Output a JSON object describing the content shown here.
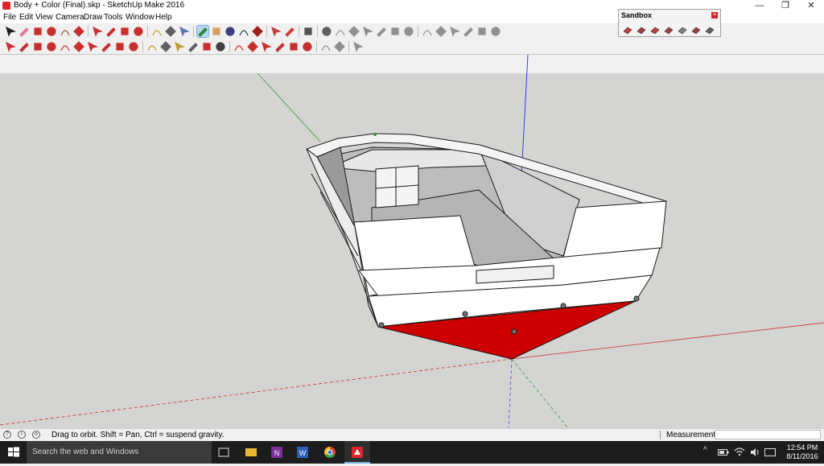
{
  "window": {
    "title": "Body + Color (Final).skp - SketchUp Make 2016",
    "controls": {
      "minimize": "—",
      "maximize": "❐",
      "close": "✕"
    }
  },
  "menu": [
    "File",
    "Edit",
    "View",
    "Camera",
    "Draw",
    "Tools",
    "Window",
    "Help"
  ],
  "toolbar_row1": [
    {
      "icon": "select-arrow-icon",
      "color": "#202020"
    },
    {
      "icon": "eraser-icon",
      "color": "#e07a9a"
    },
    {
      "icon": "pencil-line-icon",
      "color": "#c83030"
    },
    {
      "icon": "arc-icon",
      "color": "#c83030"
    },
    {
      "icon": "rectangle-icon",
      "color": "#8a5a3a"
    },
    {
      "icon": "push-pull-icon",
      "color": "#c83030"
    },
    {
      "icon": "move-icon",
      "color": "#c83030"
    },
    {
      "icon": "rotate-icon",
      "color": "#c83030"
    },
    {
      "icon": "scale-icon",
      "color": "#c83030"
    },
    {
      "icon": "offset-icon",
      "color": "#c83030"
    },
    {
      "icon": "tape-measure-icon",
      "color": "#c0a030"
    },
    {
      "icon": "text-icon",
      "color": "#606060"
    },
    {
      "icon": "paint-bucket-icon",
      "color": "#5a7ab0"
    },
    {
      "icon": "orbit-icon",
      "color": "#2a8a3a"
    },
    {
      "icon": "pan-icon",
      "color": "#d8a060"
    },
    {
      "icon": "zoom-icon",
      "color": "#404080"
    },
    {
      "icon": "zoom-extents-icon",
      "color": "#404040"
    },
    {
      "icon": "previous-view-icon",
      "color": "#a02020"
    },
    {
      "icon": "warehouse-icon",
      "color": "#c04040"
    },
    {
      "icon": "extension-icon",
      "color": "#d04040"
    },
    {
      "icon": "layout-icon",
      "color": "#505050"
    },
    {
      "icon": "iso-view-icon",
      "color": "#606060"
    },
    {
      "icon": "top-view-icon",
      "color": "#909090"
    },
    {
      "icon": "front-view-icon",
      "color": "#909090"
    },
    {
      "icon": "right-view-icon",
      "color": "#909090"
    },
    {
      "icon": "back-view-icon",
      "color": "#909090"
    },
    {
      "icon": "left-view-icon",
      "color": "#909090"
    },
    {
      "icon": "xray-icon",
      "color": "#909090"
    },
    {
      "icon": "back-edges-icon",
      "color": "#909090"
    },
    {
      "icon": "wireframe-icon",
      "color": "#909090"
    },
    {
      "icon": "hidden-line-icon",
      "color": "#909090"
    },
    {
      "icon": "shaded-icon",
      "color": "#909090"
    },
    {
      "icon": "shaded-textures-icon",
      "color": "#909090"
    },
    {
      "icon": "monochrome-icon",
      "color": "#909090"
    }
  ],
  "toolbar_row2": [
    {
      "icon": "line-icon",
      "color": "#c83030"
    },
    {
      "icon": "freehand-icon",
      "color": "#c83030"
    },
    {
      "icon": "rectangle-icon",
      "color": "#c83030"
    },
    {
      "icon": "rotated-rectangle-icon",
      "color": "#c83030"
    },
    {
      "icon": "circle-icon",
      "color": "#c83030"
    },
    {
      "icon": "polygon-icon",
      "color": "#c83030"
    },
    {
      "icon": "arc-icon",
      "color": "#c83030"
    },
    {
      "icon": "two-point-arc-icon",
      "color": "#c83030"
    },
    {
      "icon": "three-point-arc-icon",
      "color": "#c83030"
    },
    {
      "icon": "pie-icon",
      "color": "#c83030"
    },
    {
      "icon": "tape-measure-icon",
      "color": "#c0a030"
    },
    {
      "icon": "dimension-icon",
      "color": "#606060"
    },
    {
      "icon": "protractor-icon",
      "color": "#c0a030"
    },
    {
      "icon": "text-icon",
      "color": "#606060"
    },
    {
      "icon": "axes-icon",
      "color": "#c83030"
    },
    {
      "icon": "3d-text-icon",
      "color": "#404040"
    },
    {
      "icon": "move-icon",
      "color": "#c83030"
    },
    {
      "icon": "push-pull-icon",
      "color": "#c83030"
    },
    {
      "icon": "rotate-icon",
      "color": "#c83030"
    },
    {
      "icon": "follow-me-icon",
      "color": "#c83030"
    },
    {
      "icon": "scale-icon",
      "color": "#c83030"
    },
    {
      "icon": "offset-icon",
      "color": "#c83030"
    },
    {
      "icon": "section-plane-icon",
      "color": "#909090"
    },
    {
      "icon": "display-sections-icon",
      "color": "#909090"
    },
    {
      "icon": "section-cuts-icon",
      "color": "#909090"
    }
  ],
  "sandbox": {
    "title": "Sandbox",
    "close": "×",
    "tools": [
      {
        "icon": "from-contours-icon",
        "color": "#c04040"
      },
      {
        "icon": "from-scratch-icon",
        "color": "#a04040"
      },
      {
        "icon": "smoove-icon",
        "color": "#c04040"
      },
      {
        "icon": "stamp-icon",
        "color": "#a04040"
      },
      {
        "icon": "drape-icon",
        "color": "#808080"
      },
      {
        "icon": "add-detail-icon",
        "color": "#a04040"
      },
      {
        "icon": "flip-edge-icon",
        "color": "#606060"
      }
    ]
  },
  "viewport": {
    "background_color": "#d4d4d2",
    "sky_color": "#f0f0f0",
    "hull_color": "#ffffff",
    "interior_color": "#bdbdbd",
    "bottom_color": "#cc0000"
  },
  "status": {
    "text": "Drag to orbit. Shift = Pan, Ctrl = suspend gravity.",
    "measurements_label": "Measurements",
    "measurements_value": ""
  },
  "taskbar": {
    "search_placeholder": "Search the web and Windows",
    "time": "12:54 PM",
    "date": "8/11/2016"
  }
}
